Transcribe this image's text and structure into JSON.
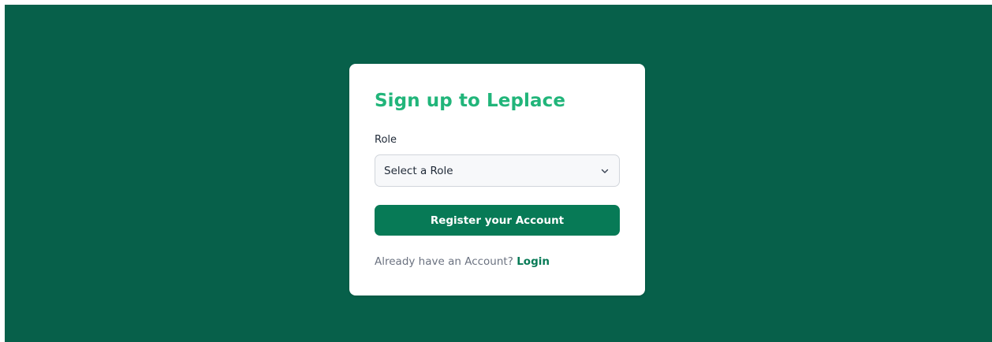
{
  "signup": {
    "title": "Sign up to Leplace",
    "role_label": "Role",
    "role_select": {
      "selected": "Select a Role",
      "icon": "chevron-down-icon"
    },
    "register_label": "Register your Account",
    "footer_text": "Already have an Account?",
    "login_label": "Login"
  },
  "colors": {
    "background": "#07604a",
    "title": "#21b57a",
    "button": "#077a56",
    "card": "#ffffff"
  }
}
